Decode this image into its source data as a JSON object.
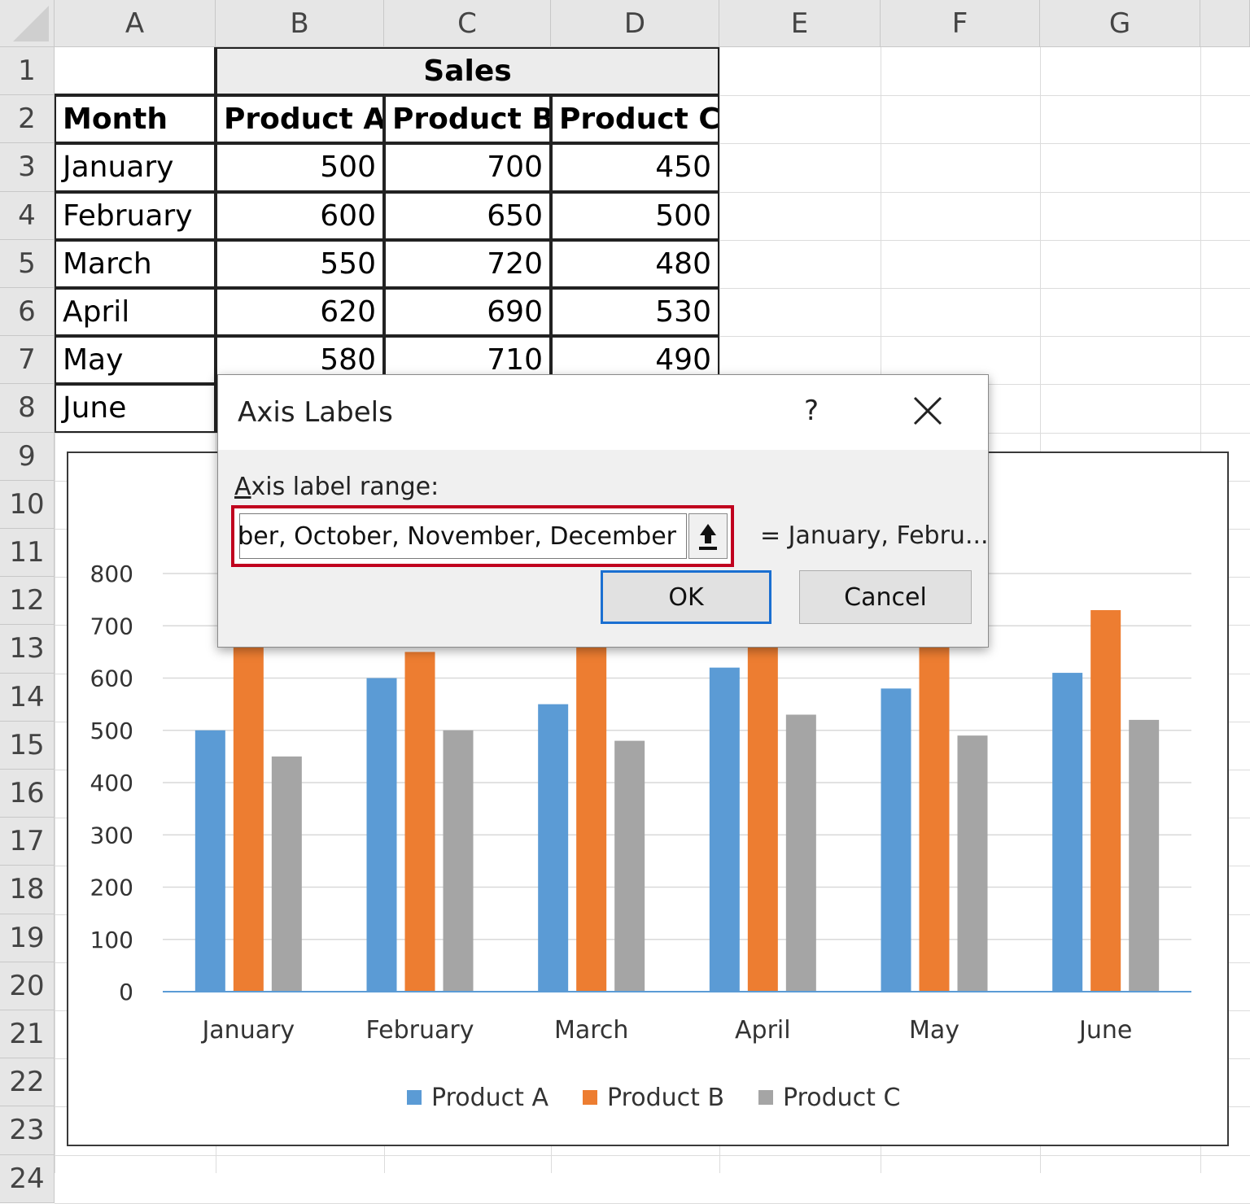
{
  "columns": [
    "A",
    "B",
    "C",
    "D",
    "E",
    "F",
    "G"
  ],
  "rows": [
    "1",
    "2",
    "3",
    "4",
    "5",
    "6",
    "7",
    "8",
    "9",
    "10",
    "11",
    "12",
    "13",
    "14",
    "15",
    "16",
    "17",
    "18",
    "19",
    "20",
    "21",
    "22",
    "23",
    "24"
  ],
  "table": {
    "merged_header": "Sales",
    "headers": [
      "Month",
      "Product A",
      "Product B",
      "Product C"
    ],
    "body": [
      [
        "January",
        "500",
        "700",
        "450"
      ],
      [
        "February",
        "600",
        "650",
        "500"
      ],
      [
        "March",
        "550",
        "720",
        "480"
      ],
      [
        "April",
        "620",
        "690",
        "530"
      ],
      [
        "May",
        "580",
        "710",
        "490"
      ],
      [
        "June",
        "",
        "",
        ""
      ]
    ]
  },
  "dialog": {
    "title": "Axis Labels",
    "help": "?",
    "range_label": "Axis label range:",
    "range_value": "iber, October, November, December",
    "preview": "= January, Febru...",
    "ok": "OK",
    "cancel": "Cancel"
  },
  "chart_data": {
    "type": "bar",
    "categories": [
      "January",
      "February",
      "March",
      "April",
      "May",
      "June"
    ],
    "series": [
      {
        "name": "Product A",
        "values": [
          500,
          600,
          550,
          620,
          580,
          610
        ],
        "color": "#5b9bd5"
      },
      {
        "name": "Product B",
        "values": [
          700,
          650,
          720,
          690,
          710,
          730
        ],
        "color": "#ed7d31"
      },
      {
        "name": "Product C",
        "values": [
          450,
          500,
          480,
          530,
          490,
          520
        ],
        "color": "#a5a5a5"
      }
    ],
    "yticks": [
      "0",
      "100",
      "200",
      "300",
      "400",
      "500",
      "600",
      "700",
      "800"
    ],
    "ylim": [
      0,
      800
    ],
    "legend": "bottom",
    "grid": true
  }
}
